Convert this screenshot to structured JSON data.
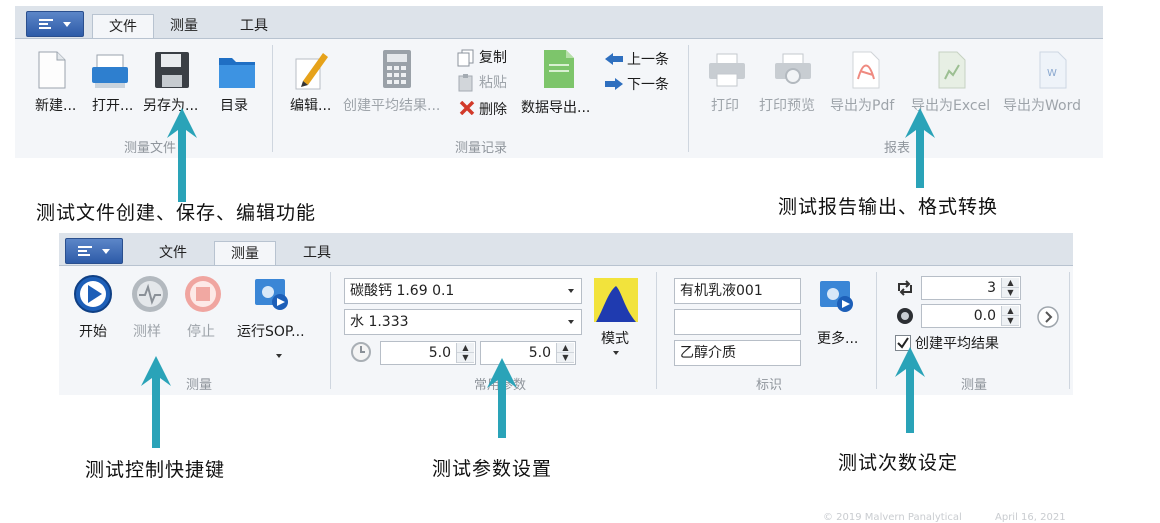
{
  "ribbon1": {
    "tabs": [
      "文件",
      "测量",
      "工具"
    ],
    "buttons": {
      "new": "新建...",
      "open": "打开...",
      "save_as": "另存为...",
      "catalog": "目录",
      "edit": "编辑...",
      "create_avg": "创建平均结果...",
      "copy": "复制",
      "paste": "粘贴",
      "delete": "删除",
      "export_data": "数据导出...",
      "prev": "上一条",
      "next": "下一条",
      "print": "打印",
      "print_preview": "打印预览",
      "export_pdf": "导出为Pdf",
      "export_excel": "导出为Excel",
      "export_word": "导出为Word"
    },
    "groups": {
      "files": "测量文件",
      "records": "测量记录",
      "report": "报表"
    }
  },
  "ribbon2": {
    "tabs": [
      "文件",
      "测量",
      "工具"
    ],
    "buttons": {
      "start": "开始",
      "sample": "测样",
      "stop": "停止",
      "run_sop": "运行SOP...",
      "mode": "模式",
      "more": "更多..."
    },
    "fields": {
      "material": "碳酸钙 1.69 0.1",
      "dispersant": "水 1.333",
      "time_1": "5.0",
      "time_2": "5.0",
      "label_1": "有机乳液001",
      "label_2": "",
      "label_3": "乙醇介质",
      "repeat_count": "3",
      "delay": "0.0",
      "create_avg_checkbox": "创建平均结果"
    },
    "groups": {
      "measure": "测量",
      "common_params": "常用参数",
      "identify": "标识",
      "measure2": "测量"
    }
  },
  "annotations": {
    "file_ops": "测试文件创建、保存、编辑功能",
    "report_output": "测试报告输出、格式转换",
    "control_shortcuts": "测试控制快捷键",
    "param_settings": "测试参数设置",
    "repeat_settings": "测试次数设定"
  },
  "footer": {
    "copyright": "© 2019 Malvern Panalytical",
    "date": "April 16, 2021"
  },
  "colors": {
    "arrow": "#2aa3b8",
    "app_button": "#2d5ba8",
    "disabled_text": "#9ea4aa"
  }
}
